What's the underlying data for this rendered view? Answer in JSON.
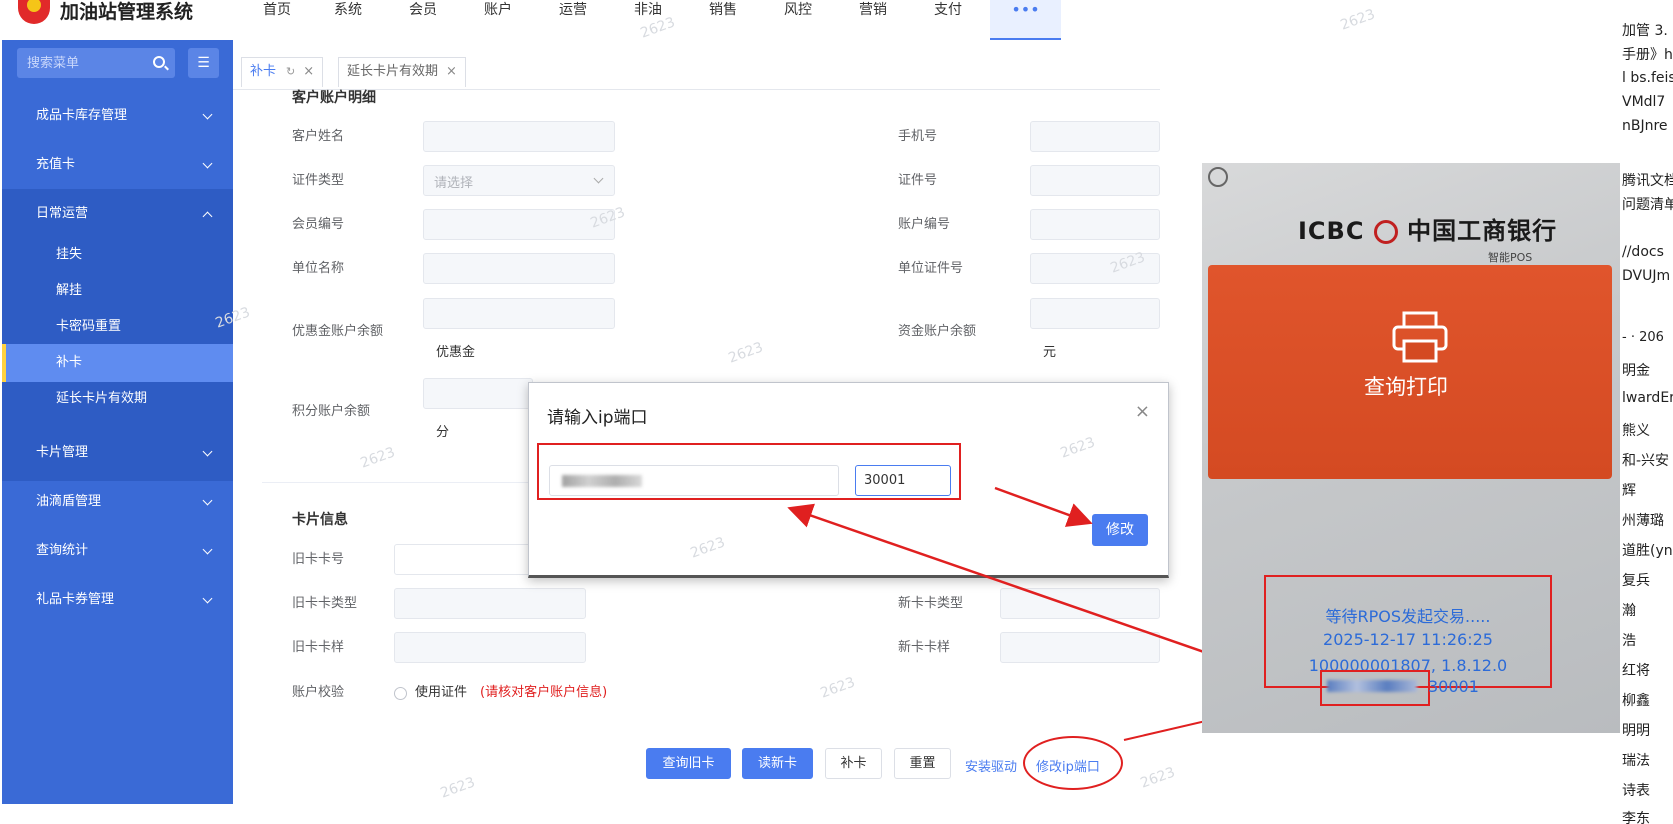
{
  "app": {
    "title": "加油站管理系统"
  },
  "nav": {
    "items": [
      "首页",
      "系统",
      "会员",
      "账户",
      "运营",
      "非油",
      "销售",
      "风控",
      "营销",
      "支付"
    ],
    "more": "•••"
  },
  "sidebar": {
    "search_placeholder": "搜索菜单",
    "collapse_icon": "☰",
    "items": [
      "成品卡库存管理",
      "充值卡",
      "日常运营",
      "卡片管理",
      "油滴盾管理",
      "查询统计",
      "礼品卡券管理"
    ],
    "sub_items": [
      "挂失",
      "解挂",
      "卡密码重置",
      "补卡",
      "延长卡片有效期"
    ]
  },
  "tabs": [
    {
      "label": "补卡"
    },
    {
      "label": "延长卡片有效期"
    }
  ],
  "customer_section": {
    "title": "客户账户明细",
    "name_label": "客户姓名",
    "phone_label": "手机号",
    "id_type_label": "证件类型",
    "id_type_placeholder": "请选择",
    "id_no_label": "证件号",
    "member_no_label": "会员编号",
    "account_no_label": "账户编号",
    "company_label": "单位名称",
    "company_id_label": "单位证件号",
    "discount_balance_label": "优惠金账户余额",
    "discount_unit": "优惠金",
    "fund_balance_label": "资金账户余额",
    "fund_unit": "元",
    "points_balance_label": "积分账户余额",
    "points_unit": "分"
  },
  "card_section": {
    "title": "卡片信息",
    "old_card_no_label": "旧卡卡号",
    "old_card_type_label": "旧卡卡类型",
    "new_card_type_label": "新卡卡类型",
    "old_card_style_label": "旧卡卡样",
    "new_card_style_label": "新卡卡样",
    "verify_label": "账户校验",
    "verify_option": "使用证件",
    "verify_hint": "(请核对客户账户信息)"
  },
  "actions": {
    "query_old": "查询旧卡",
    "read_new": "读新卡",
    "reissue": "补卡",
    "reset": "重置",
    "install_driver": "安装驱动",
    "modify_ip": "修改ip端口"
  },
  "modal": {
    "title": "请输入ip端口",
    "close": "×",
    "port_value": "30001",
    "confirm": "修改"
  },
  "pos": {
    "bank_prefix": "ICBC",
    "bank_name": "中国工商银行",
    "sub": "智能POS",
    "tile_label": "查询打印",
    "line1": "等待RPOS发起交易.....",
    "line2": "2025-12-17 11:26:25",
    "line3": "100000001807, 1.8.12.0",
    "port": "30001"
  },
  "right_strip": [
    "加管 3.",
    "手册》ht",
    "l bs.feis",
    "VMdl7",
    "nBJnre",
    "腾讯文档",
    "问题清单",
    "//docs",
    "DVUJm",
    "- · 206",
    "明金",
    "lwardEr",
    "熊义",
    "和-兴安",
    "辉",
    "州薄璐",
    "道胜(yn",
    "复兵",
    "瀚",
    "浩",
    "红将",
    "柳鑫",
    "明明",
    "瑞法",
    "诗表",
    "李东"
  ],
  "watermark": "2623",
  "colors": {
    "primary": "#4a7cf0",
    "sidebar": "#3a6ad6",
    "annotation": "#e02020"
  }
}
